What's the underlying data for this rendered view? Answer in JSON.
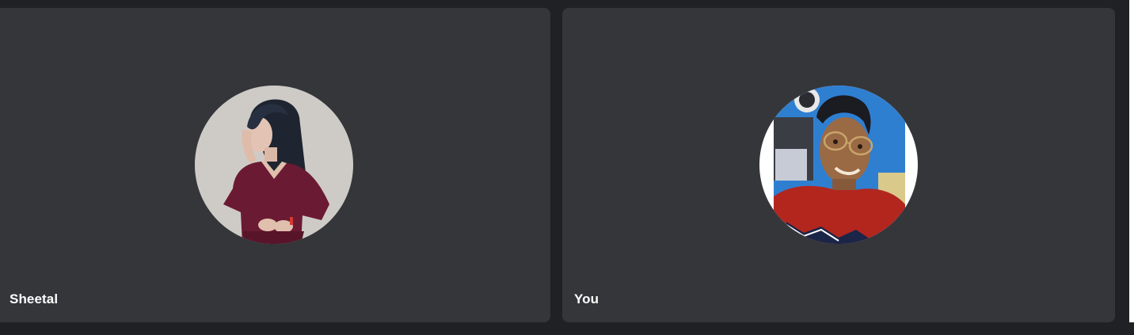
{
  "participants": [
    {
      "name": "Sheetal",
      "avatar_icon": "participant-photo-woman",
      "colors": {
        "background": "#c9c6c3",
        "dress": "#6b1a33",
        "hair": "#1e2530"
      }
    },
    {
      "name": "You",
      "avatar_icon": "participant-photo-man",
      "colors": {
        "background": "#2f7fd1",
        "sweater": "#b3261e",
        "hair": "#1b1b22"
      }
    }
  ],
  "theme": {
    "page_background": "#202124",
    "tile_background": "#35363a",
    "label_color": "#ffffff"
  }
}
